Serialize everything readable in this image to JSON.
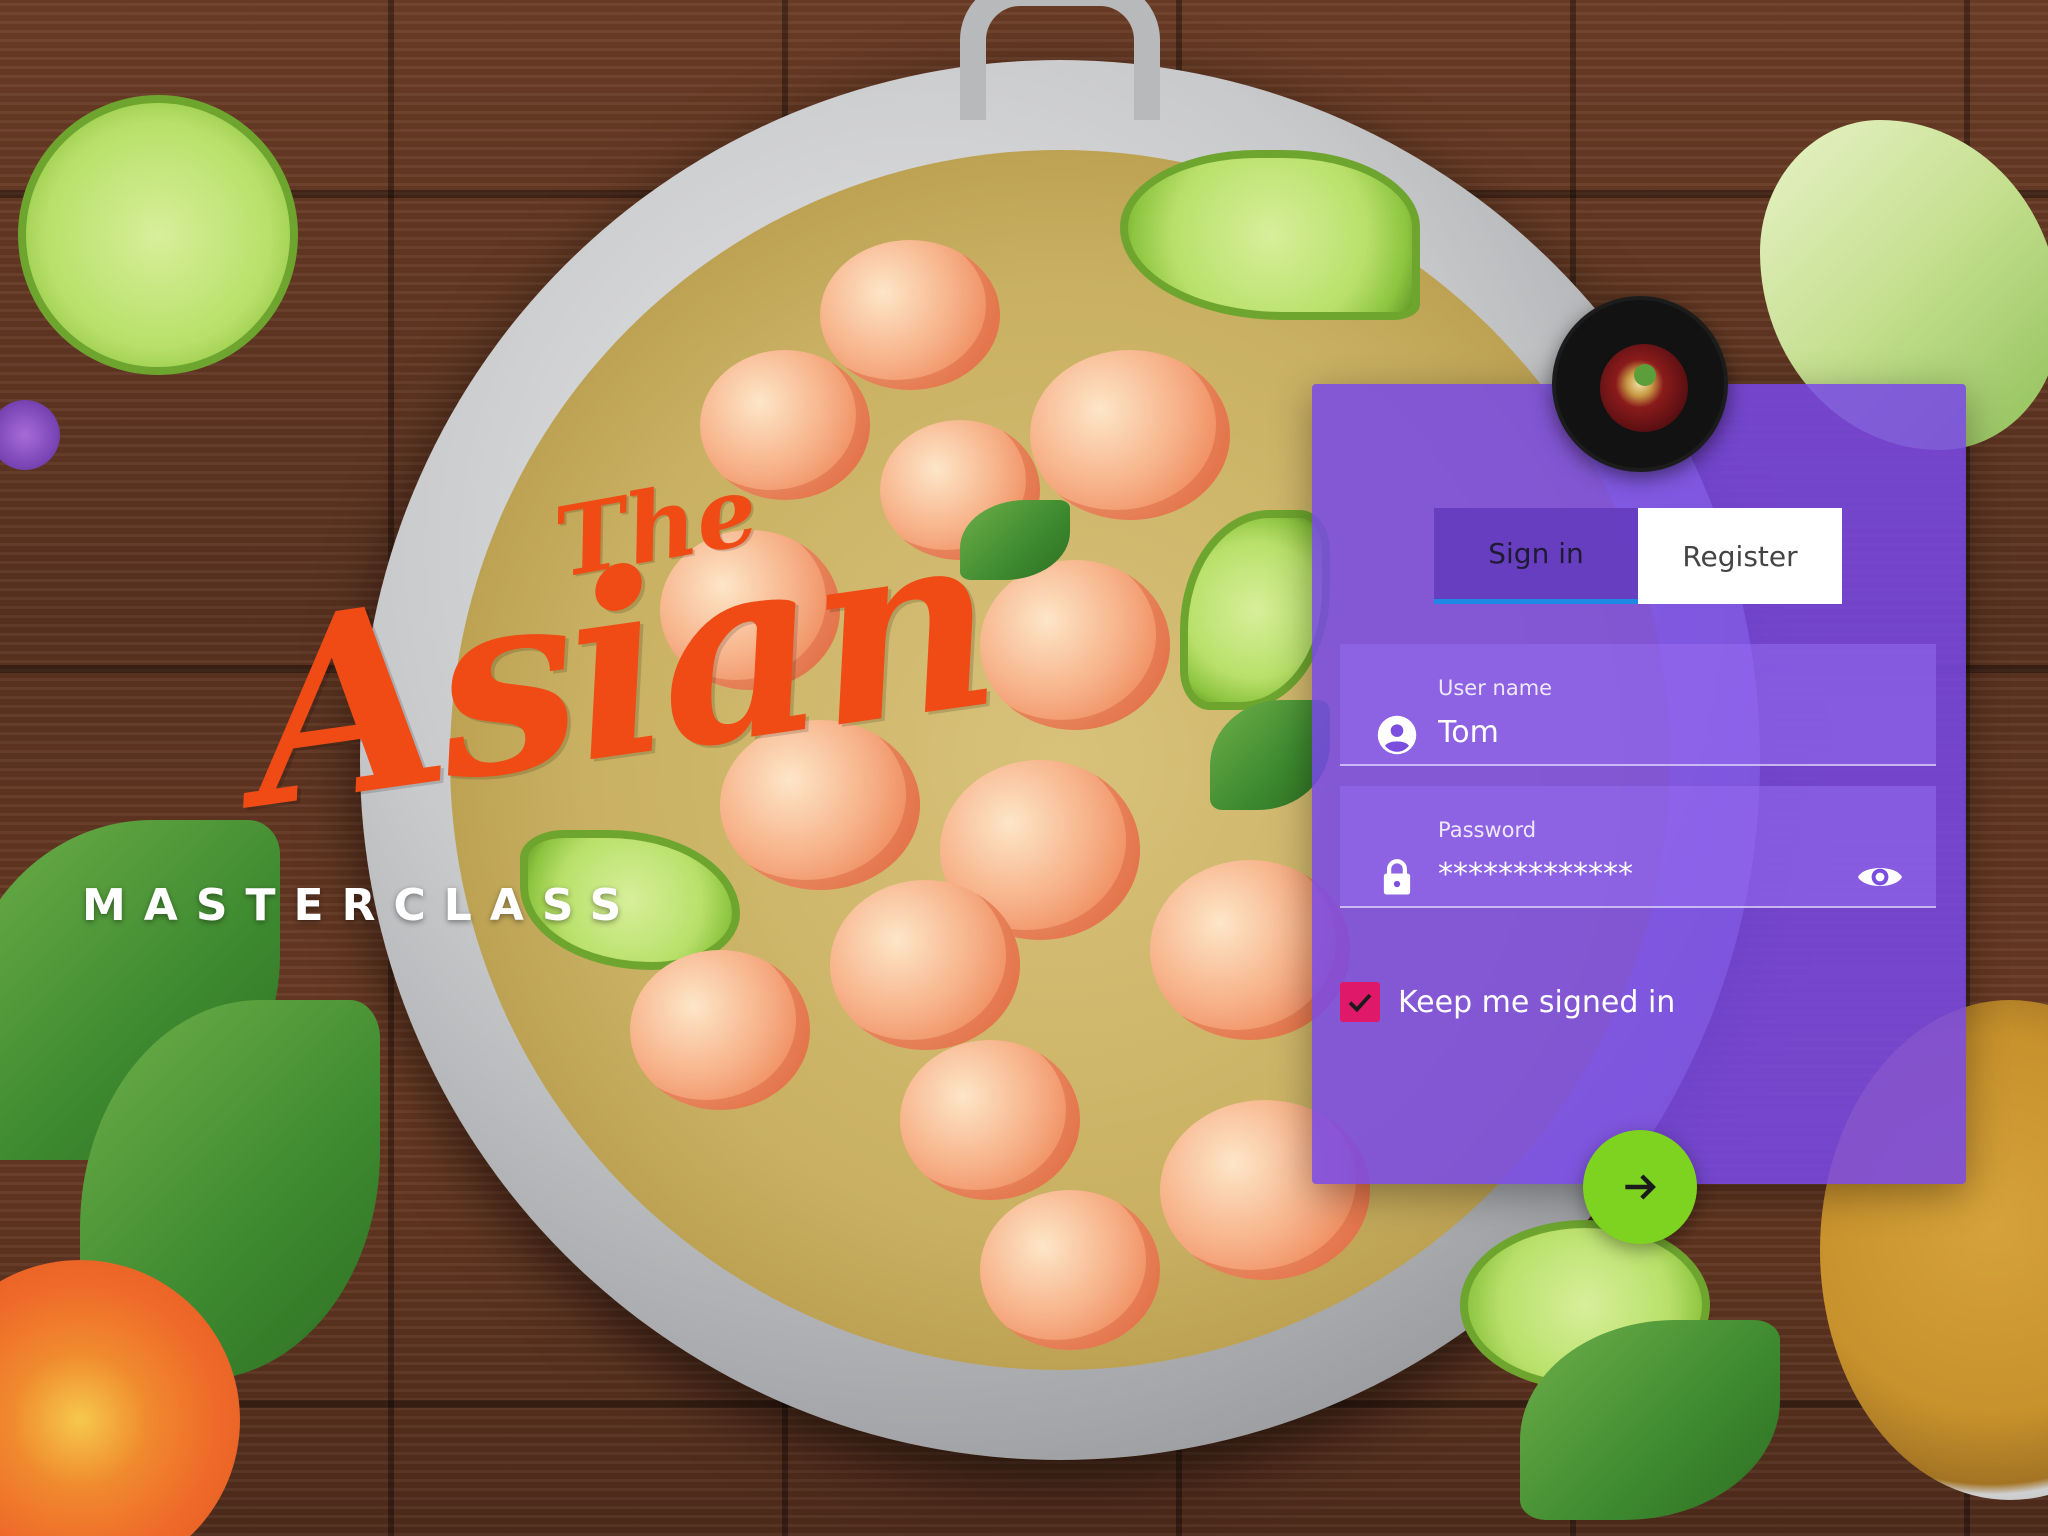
{
  "brand": {
    "the": "The",
    "asian": "Asian",
    "masterclass": "MASTERCLASS",
    "color": "#f04a15"
  },
  "panel": {
    "background": "#7848e6",
    "avatar_icon": "dish-avatar"
  },
  "tabs": [
    {
      "label": "Sign in",
      "active": true
    },
    {
      "label": "Register",
      "active": false
    }
  ],
  "username": {
    "label": "User name",
    "value": "Tom",
    "icon": "account-circle-icon"
  },
  "password": {
    "label": "Password",
    "value": "*************",
    "icon": "lock-icon",
    "toggle_icon": "eye-icon"
  },
  "keep_signed_in": {
    "label": "Keep me signed in",
    "checked": true,
    "color": "#e0186a"
  },
  "submit": {
    "icon": "arrow-right-icon",
    "color": "#7ed321"
  }
}
